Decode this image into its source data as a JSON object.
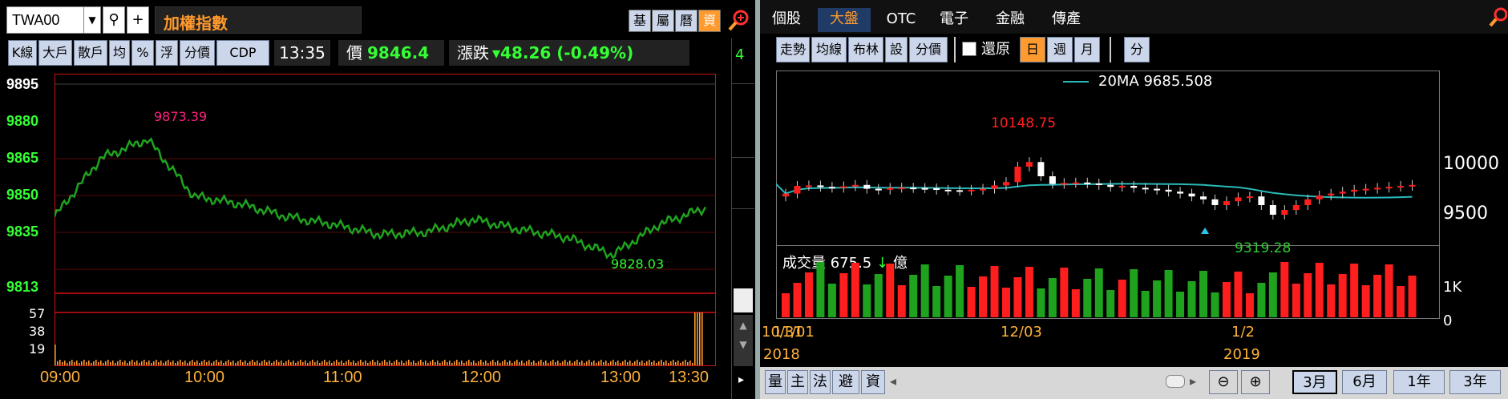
{
  "left": {
    "code": "TWA00",
    "index_title": "加權指數",
    "top_tools": [
      "基",
      "屬",
      "曆",
      "資"
    ],
    "toolbar": [
      "K線",
      "大戶",
      "散戶",
      "均",
      "%",
      "浮",
      "分價",
      "CDP"
    ],
    "time": "13:35",
    "price_label": "價",
    "price": "9846.4",
    "change_label": "漲跌",
    "change": "▾48.26 (-0.49%)",
    "y_labels": [
      "9895",
      "9880",
      "9865",
      "9850",
      "9835",
      "9813"
    ],
    "vol_labels": [
      "57",
      "38",
      "19"
    ],
    "x_labels": [
      "09:00",
      "10:00",
      "11:00",
      "12:00",
      "13:00",
      "13:30"
    ],
    "high_label": "9873.39",
    "low_label": "9828.03",
    "side_mark": "4"
  },
  "right": {
    "tabs": [
      "個股",
      "大盤",
      "OTC",
      "電子",
      "金融",
      "傳產"
    ],
    "toolbar": [
      "走勢",
      "均線",
      "布林",
      "設",
      "分價"
    ],
    "restore_label": "還原",
    "periods": [
      "日",
      "週",
      "月"
    ],
    "min_label": "分",
    "ma_label": "20MA 9685.508",
    "hi_label": "10148.75",
    "lo_label": "9319.28",
    "price_axis": [
      "10000",
      "9500"
    ],
    "vol_title": "成交量 675.5",
    "vol_arrow": "↓",
    "vol_unit": "億",
    "vol_axis": [
      "1K",
      "0"
    ],
    "x_labels": [
      "10/31",
      "11/01",
      "12/03",
      "1/2"
    ],
    "years": [
      "2018",
      "2019"
    ],
    "bottom_tools": [
      "量",
      "主",
      "法",
      "避",
      "資"
    ],
    "ranges": [
      "3月",
      "6月",
      "1年",
      "3年"
    ]
  },
  "chart_data": {
    "type": "line",
    "title": "加權指數",
    "x": [
      "09:00",
      "10:00",
      "11:00",
      "12:00",
      "13:00",
      "13:30"
    ],
    "series": [
      {
        "values": [
          9843,
          9866,
          9873.39,
          9851,
          9848,
          9843,
          9840,
          9836,
          9837,
          9842,
          9838,
          9835,
          9828.03,
          9840,
          9846.4
        ]
      }
    ],
    "ylim": [
      9813,
      9895
    ],
    "xlabel": "",
    "ylabel": ""
  }
}
